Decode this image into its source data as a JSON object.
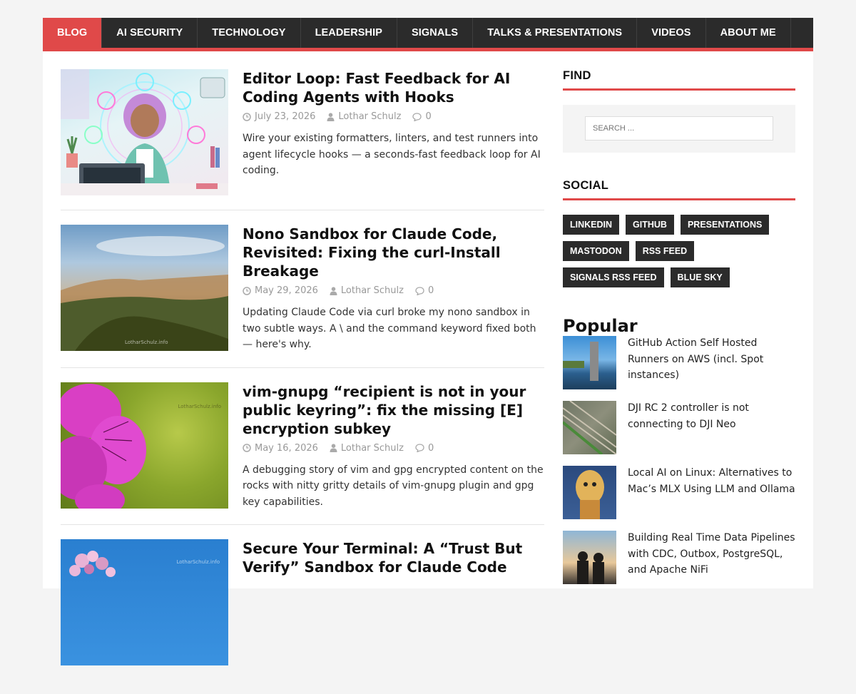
{
  "nav": {
    "items": [
      "BLOG",
      "AI SECURITY",
      "TECHNOLOGY",
      "LEADERSHIP",
      "SIGNALS",
      "TALKS & PRESENTATIONS",
      "VIDEOS",
      "ABOUT ME"
    ],
    "active": "BLOG"
  },
  "posts": [
    {
      "title": "Editor Loop: Fast Feedback for AI Coding Agents with Hooks",
      "date": "July 23, 2026",
      "author": "Lothar Schulz",
      "comments": "0",
      "excerpt": "Wire your existing formatters, linters, and test runners into agent lifecycle hooks — a seconds-fast feedback loop for AI coding."
    },
    {
      "title": "Nono Sandbox for Claude Code, Revisited: Fixing the curl-Install Breakage",
      "date": "May 29, 2026",
      "author": "Lothar Schulz",
      "comments": "0",
      "excerpt": "Updating Claude Code via curl broke my nono sandbox in two subtle ways. A \\ and the command keyword fixed both — here's why.",
      "watermark": "LotharSchulz.info"
    },
    {
      "title": "vim-gnupg “recipient is not in your public keyring”: fix the missing [E] encryption subkey",
      "date": "May 16, 2026",
      "author": "Lothar Schulz",
      "comments": "0",
      "excerpt": "A debugging story of vim and gpg encrypted content on the rocks with nitty gritty details of vim-gnupg plugin and gpg key capabilities.",
      "watermark": "LotharSchulz.info"
    },
    {
      "title": "Secure Your Terminal: A “Trust But Verify” Sandbox for Claude Code",
      "watermark": "LotharSchulz.info"
    }
  ],
  "sidebar": {
    "find_title": "FIND",
    "search_placeholder": "SEARCH ...",
    "social_title": "SOCIAL",
    "social_links": [
      "LINKEDIN",
      "GITHUB",
      "PRESENTATIONS",
      "MASTODON",
      "RSS FEED",
      "SIGNALS RSS FEED",
      "BLUE SKY"
    ],
    "popular_title": "Popular",
    "popular": [
      "GitHub Action Self Hosted Runners on AWS (incl. Spot instances)",
      "DJI RC 2 controller is not connecting to DJI Neo",
      "Local AI on Linux: Alternatives to Mac’s MLX Using LLM and Ollama",
      "Building Real Time Data Pipelines with CDC, Outbox, PostgreSQL, and Apache NiFi"
    ]
  },
  "colors": {
    "accent": "#e04949",
    "nav_bg": "#2b2b2b"
  }
}
